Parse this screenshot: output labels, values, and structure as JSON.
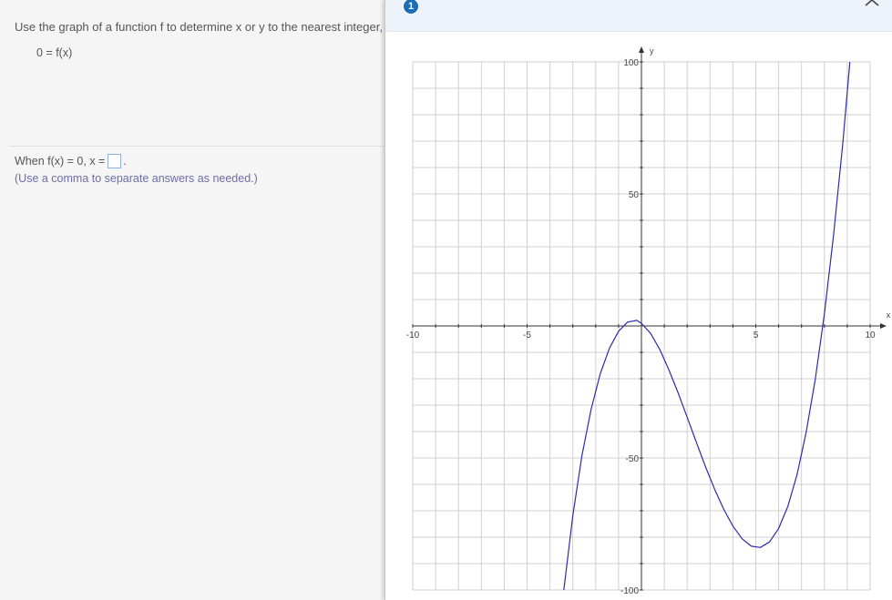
{
  "question": {
    "prompt": "Use the graph of a function f to determine x or y to the nearest integer,",
    "equation": "0 = f(x)",
    "answer_prefix": "When f(x) = 0, x =",
    "answer_value": "",
    "answer_suffix": ".",
    "hint": "(Use a comma to separate answers as needed.)"
  },
  "popup": {
    "info_badge": "1",
    "close_icon": "close-icon"
  },
  "chart_data": {
    "type": "line",
    "xlabel": "x",
    "ylabel": "y",
    "xlim": [
      -10,
      10
    ],
    "ylim": [
      -100,
      100
    ],
    "grid": true,
    "x_ticks": [
      {
        "value": -10,
        "label": "-10"
      },
      {
        "value": -5,
        "label": "-5"
      },
      {
        "value": 5,
        "label": "5"
      },
      {
        "value": 10,
        "label": "10"
      }
    ],
    "y_ticks": [
      {
        "value": 100,
        "label": "100"
      },
      {
        "value": 50,
        "label": "50"
      },
      {
        "value": -50,
        "label": "-50"
      },
      {
        "value": -100,
        "label": "-100"
      }
    ],
    "series": [
      {
        "color": "#2b2bb0",
        "x": [
          -3.4,
          -3.0,
          -2.6,
          -2.2,
          -1.8,
          -1.4,
          -1.0,
          -0.6,
          -0.2,
          0.0,
          0.4,
          0.8,
          1.2,
          1.6,
          2.0,
          2.4,
          2.8,
          3.2,
          3.6,
          4.0,
          4.4,
          4.8,
          5.2,
          5.6,
          6.0,
          6.4,
          6.8,
          7.2,
          7.6,
          8.0,
          8.4,
          8.8,
          9.2,
          9.4
        ],
        "y": [
          -100.3,
          -71.8,
          -49.1,
          -31.5,
          -18.1,
          -8.4,
          -2.0,
          1.5,
          2.1,
          1.0,
          -2.8,
          -8.9,
          -16.6,
          -25.3,
          -34.6,
          -44.0,
          -53.3,
          -61.8,
          -69.5,
          -75.8,
          -80.6,
          -83.4,
          -83.9,
          -81.8,
          -76.7,
          -68.4,
          -56.4,
          -40.4,
          -20.2,
          4.6,
          34.2,
          68.8,
          108.5,
          130.6
        ]
      }
    ]
  }
}
